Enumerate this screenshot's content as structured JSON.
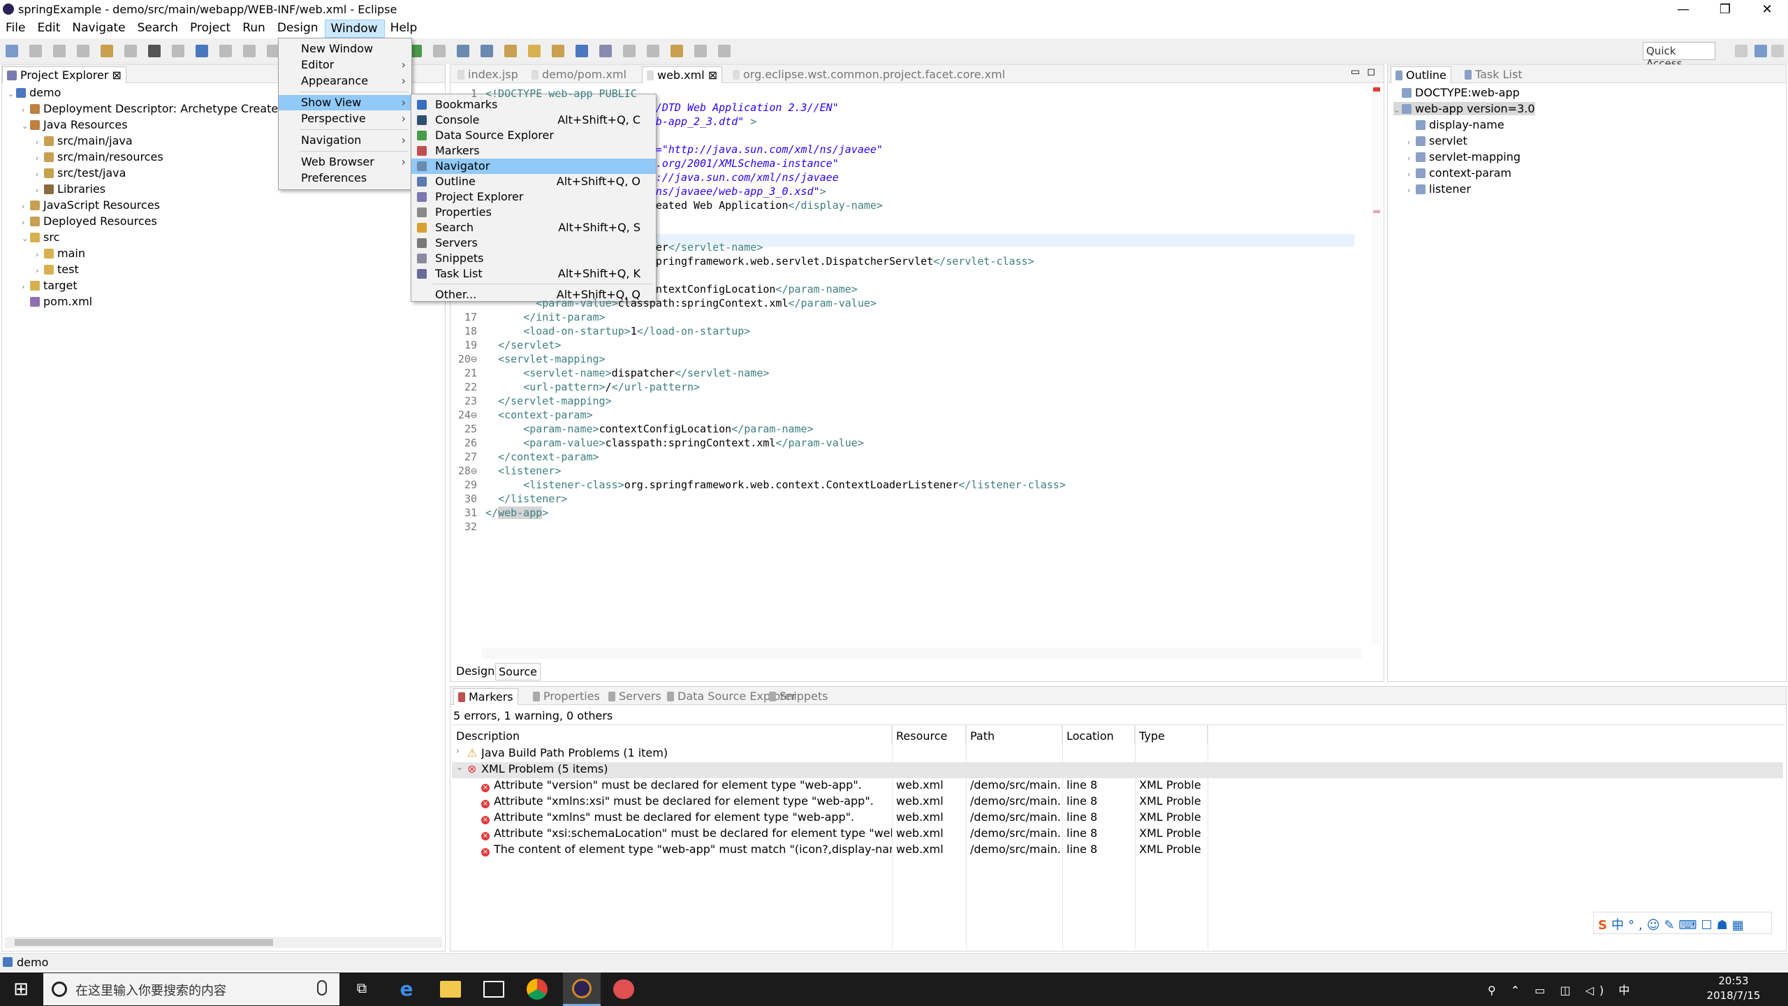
{
  "window": {
    "title": "springExample - demo/src/main/webapp/WEB-INF/web.xml - Eclipse"
  },
  "menubar": [
    "File",
    "Edit",
    "Navigate",
    "Search",
    "Project",
    "Run",
    "Design",
    "Window",
    "Help"
  ],
  "quick_access": "Quick Access",
  "project_explorer": {
    "tab": "Project Explorer",
    "tree": [
      {
        "t": "demo",
        "lvl": 0,
        "tri": "v",
        "c": "#4a78c0"
      },
      {
        "t": "Deployment Descriptor: Archetype Created W",
        "lvl": 1,
        "tri": ">",
        "c": "#c08040"
      },
      {
        "t": "Java Resources",
        "lvl": 1,
        "tri": "v",
        "c": "#c08040"
      },
      {
        "t": "src/main/java",
        "lvl": 2,
        "tri": ">",
        "c": "#c8a050"
      },
      {
        "t": "src/main/resources",
        "lvl": 2,
        "tri": ">",
        "c": "#c8a050"
      },
      {
        "t": "src/test/java",
        "lvl": 2,
        "tri": ">",
        "c": "#c8a050"
      },
      {
        "t": "Libraries",
        "lvl": 2,
        "tri": ">",
        "c": "#8a6a40"
      },
      {
        "t": "JavaScript Resources",
        "lvl": 1,
        "tri": ">",
        "c": "#c8a050"
      },
      {
        "t": "Deployed Resources",
        "lvl": 1,
        "tri": ">",
        "c": "#c8a050"
      },
      {
        "t": "src",
        "lvl": 1,
        "tri": "v",
        "c": "#d8b050"
      },
      {
        "t": "main",
        "lvl": 2,
        "tri": ">",
        "c": "#d8b050"
      },
      {
        "t": "test",
        "lvl": 2,
        "tri": ">",
        "c": "#d8b050"
      },
      {
        "t": "target",
        "lvl": 1,
        "tri": ">",
        "c": "#d8b050"
      },
      {
        "t": "pom.xml",
        "lvl": 1,
        "tri": "",
        "c": "#9070b0"
      }
    ]
  },
  "editor": {
    "tabs": [
      "index.jsp",
      "demo/pom.xml",
      "web.xml",
      "org.eclipse.wst.common.project.facet.core.xml"
    ],
    "bottom_tabs": [
      "Design",
      "Source"
    ]
  },
  "code_lines": [
    {
      "n": "1",
      "h": "<span class='tg'>&lt;!DOCTYPE web-app PUBLIC</span>"
    },
    {
      "n": "",
      "h": "                           <span class='sv'>/DTD Web Application 2.3//EN\"</span>"
    },
    {
      "n": "",
      "h": "                           <span class='sv'>b-app_2_3.dtd\"</span> <span class='tg'>&gt;</span>"
    },
    {
      "n": "",
      "h": ""
    },
    {
      "n": "",
      "h": "                           <span class='sv'>=\"http://java.sun.com/xml/ns/javaee\"</span>"
    },
    {
      "n": "",
      "h": "                           <span class='sv'>.org/2001/XMLSchema-instance\"</span>"
    },
    {
      "n": "",
      "h": "                           <span class='sv'>://java.sun.com/xml/ns/javaee</span>"
    },
    {
      "n": "",
      "h": "                           <span class='sv'>ns/javaee/web-app_3_0.xsd\"</span><span class='tg'>&gt;</span>"
    },
    {
      "n": "",
      "h": "                           eated Web Application<span class='tg'>&lt;/display-name&gt;</span>"
    },
    {
      "n": "",
      "h": ""
    },
    {
      "n": "",
      "h": ""
    },
    {
      "n": "",
      "h": "                           er<span class='tg'>&lt;/servlet-name&gt;</span>"
    },
    {
      "n": "",
      "h": "                           pringframework.web.servlet.DispatcherServlet<span class='tg'>&lt;/servlet-class&gt;</span>"
    },
    {
      "n": "",
      "h": ""
    },
    {
      "n": "",
      "h": "                           ntextConfigLocation<span class='tg'>&lt;/param-name&gt;</span>"
    },
    {
      "n": "",
      "h": "        <span class='tg'>&lt;param-value&gt;</span>classpath:springContext.xml<span class='tg'>&lt;/param-value&gt;</span>"
    },
    {
      "n": "17",
      "h": "      <span class='tg'>&lt;/init-param&gt;</span>"
    },
    {
      "n": "18",
      "h": "      <span class='tg'>&lt;load-on-startup&gt;</span>1<span class='tg'>&lt;/load-on-startup&gt;</span>"
    },
    {
      "n": "19",
      "h": "  <span class='tg'>&lt;/servlet&gt;</span>"
    },
    {
      "n": "20⊖",
      "h": "  <span class='tg'>&lt;servlet-mapping&gt;</span>"
    },
    {
      "n": "21",
      "h": "      <span class='tg'>&lt;servlet-name&gt;</span>dispatcher<span class='tg'>&lt;/servlet-name&gt;</span>"
    },
    {
      "n": "22",
      "h": "      <span class='tg'>&lt;url-pattern&gt;</span>/<span class='tg'>&lt;/url-pattern&gt;</span>"
    },
    {
      "n": "23",
      "h": "  <span class='tg'>&lt;/servlet-mapping&gt;</span>"
    },
    {
      "n": "24⊖",
      "h": "  <span class='tg'>&lt;context-param&gt;</span>"
    },
    {
      "n": "25",
      "h": "      <span class='tg'>&lt;param-name&gt;</span>contextConfigLocation<span class='tg'>&lt;/param-name&gt;</span>"
    },
    {
      "n": "26",
      "h": "      <span class='tg'>&lt;param-value&gt;</span>classpath:springContext.xml<span class='tg'>&lt;/param-value&gt;</span>"
    },
    {
      "n": "27",
      "h": "  <span class='tg'>&lt;/context-param&gt;</span>"
    },
    {
      "n": "28⊖",
      "h": "  <span class='tg'>&lt;listener&gt;</span>"
    },
    {
      "n": "29",
      "h": "      <span class='tg'>&lt;listener-class&gt;</span>org.springframework.web.context.ContextLoaderListener<span class='tg'>&lt;/listener-class&gt;</span>"
    },
    {
      "n": "30",
      "h": "  <span class='tg'>&lt;/listener&gt;</span>"
    },
    {
      "n": "31",
      "h": "<span class='tg'>&lt;/</span><span class='tg' style='background:#d4d4d4'>web-app</span><span class='tg'>&gt;</span>"
    },
    {
      "n": "32",
      "h": ""
    }
  ],
  "outline": {
    "tabs": [
      "Outline",
      "Task List"
    ],
    "tree": [
      {
        "t": "DOCTYPE:web-app",
        "lvl": 0,
        "tri": ""
      },
      {
        "t": "web-app version=3.0",
        "lvl": 0,
        "tri": "v",
        "sel": true
      },
      {
        "t": "display-name",
        "lvl": 1,
        "tri": ""
      },
      {
        "t": "servlet",
        "lvl": 1,
        "tri": ">"
      },
      {
        "t": "servlet-mapping",
        "lvl": 1,
        "tri": ">"
      },
      {
        "t": "context-param",
        "lvl": 1,
        "tri": ">"
      },
      {
        "t": "listener",
        "lvl": 1,
        "tri": ">"
      }
    ]
  },
  "window_menu": [
    {
      "label": "New Window",
      "arrow": false,
      "sep_after": false
    },
    {
      "label": "Editor",
      "arrow": true,
      "sep_after": false
    },
    {
      "label": "Appearance",
      "arrow": true,
      "sep_after": true
    },
    {
      "label": "Show View",
      "arrow": true,
      "sep_after": false,
      "hl": true
    },
    {
      "label": "Perspective",
      "arrow": true,
      "sep_after": true
    },
    {
      "label": "Navigation",
      "arrow": true,
      "sep_after": true
    },
    {
      "label": "Web Browser",
      "arrow": true,
      "sep_after": false
    },
    {
      "label": "Preferences",
      "arrow": false,
      "sep_after": false
    }
  ],
  "show_view_menu": [
    {
      "label": "Bookmarks",
      "sc": "",
      "c": "#3a6fc0"
    },
    {
      "label": "Console",
      "sc": "Alt+Shift+Q, C",
      "c": "#305070"
    },
    {
      "label": "Data Source Explorer",
      "sc": "",
      "c": "#4a9a4a"
    },
    {
      "label": "Markers",
      "sc": "",
      "c": "#c05050"
    },
    {
      "label": "Navigator",
      "sc": "",
      "c": "#6a8ab0",
      "hl": true
    },
    {
      "label": "Outline",
      "sc": "Alt+Shift+Q, O",
      "c": "#5a7ab0"
    },
    {
      "label": "Project Explorer",
      "sc": "",
      "c": "#7a7ab0"
    },
    {
      "label": "Properties",
      "sc": "",
      "c": "#8a8a8a"
    },
    {
      "label": "Search",
      "sc": "Alt+Shift+Q, S",
      "c": "#d8a030"
    },
    {
      "label": "Servers",
      "sc": "",
      "c": "#7a7a7a"
    },
    {
      "label": "Snippets",
      "sc": "",
      "c": "#8a8aa0"
    },
    {
      "label": "Task List",
      "sc": "Alt+Shift+Q, K",
      "c": "#6a6a9a",
      "sep_after": true
    },
    {
      "label": "Other...",
      "sc": "Alt+Shift+Q, Q",
      "c": ""
    }
  ],
  "bottom": {
    "tabs": [
      "Markers",
      "Properties",
      "Servers",
      "Data Source Explorer",
      "Snippets"
    ],
    "summary": "5 errors, 1 warning, 0 others",
    "columns": [
      "Description",
      "Resource",
      "Path",
      "Location",
      "Type"
    ],
    "groups": [
      {
        "label": "Java Build Path Problems (1 item)",
        "tri": ">",
        "kind": "warn"
      },
      {
        "label": "XML Problem (5 items)",
        "tri": "v",
        "kind": "err"
      }
    ],
    "rows": [
      {
        "d": "Attribute \"version\" must be declared for element type \"web-app\".",
        "r": "web.xml",
        "p": "/demo/src/main...",
        "l": "line 8",
        "t": "XML Proble"
      },
      {
        "d": "Attribute \"xmlns:xsi\" must be declared for element type \"web-app\".",
        "r": "web.xml",
        "p": "/demo/src/main...",
        "l": "line 8",
        "t": "XML Proble"
      },
      {
        "d": "Attribute \"xmlns\" must be declared for element type \"web-app\".",
        "r": "web.xml",
        "p": "/demo/src/main...",
        "l": "line 8",
        "t": "XML Proble"
      },
      {
        "d": "Attribute \"xsi:schemaLocation\" must be declared for element type \"web-app\"",
        "r": "web.xml",
        "p": "/demo/src/main...",
        "l": "line 8",
        "t": "XML Proble"
      },
      {
        "d": "The content of element type \"web-app\" must match \"(icon?,display-name?,de",
        "r": "web.xml",
        "p": "/demo/src/main...",
        "l": "line 8",
        "t": "XML Proble"
      }
    ]
  },
  "status": {
    "text": "demo"
  },
  "taskbar": {
    "search_placeholder": "在这里输入你要搜索的内容",
    "time": "20:53",
    "date": "2018/7/15",
    "ime": "中"
  },
  "colors": {
    "menu_highlight": "#91c9f7",
    "taskbar": "#1b1b1b",
    "error": "#e03a3a"
  }
}
